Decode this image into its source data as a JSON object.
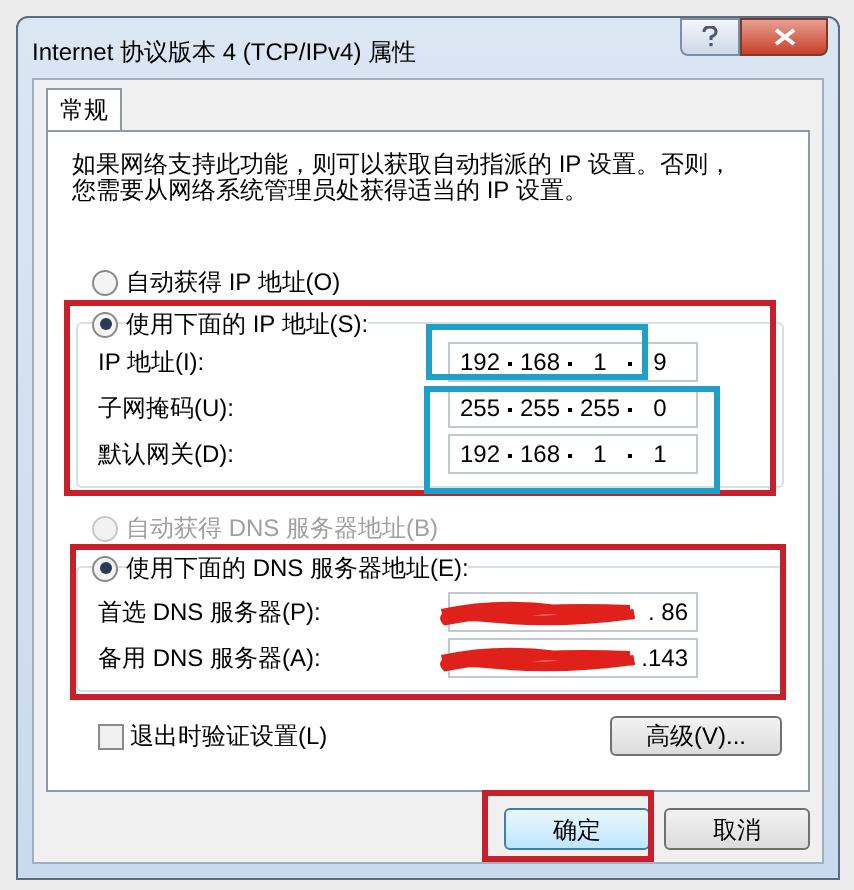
{
  "window": {
    "title": "Internet 协议版本 4 (TCP/IPv4) 属性"
  },
  "tabs": [
    {
      "label": "常规",
      "selected": true
    }
  ],
  "description_lines": [
    "如果网络支持此功能，则可以获取自动指派的 IP 设置。否则，",
    "您需要从网络系统管理员处获得适当的 IP 设置。"
  ],
  "ip_mode": [
    {
      "label": "自动获得 IP 地址(O)",
      "selected": false,
      "disabled": false
    },
    {
      "label": "使用下面的 IP 地址(S):",
      "selected": true,
      "disabled": false
    }
  ],
  "ip_fields": [
    {
      "label": "IP 地址(I):",
      "octets": [
        "192",
        "168",
        "1",
        "9"
      ]
    },
    {
      "label": "子网掩码(U):",
      "octets": [
        "255",
        "255",
        "255",
        "0"
      ]
    },
    {
      "label": "默认网关(D):",
      "octets": [
        "192",
        "168",
        "1",
        "1"
      ]
    }
  ],
  "dns_mode": [
    {
      "label": "自动获得 DNS 服务器地址(B)",
      "selected": false,
      "disabled": true
    },
    {
      "label": "使用下面的 DNS 服务器地址(E):",
      "selected": true,
      "disabled": false
    }
  ],
  "dns_fields": [
    {
      "label": "首选 DNS 服务器(P):",
      "visible_value": ". 86",
      "redacted": true
    },
    {
      "label": "备用 DNS 服务器(A):",
      "visible_value": ".143",
      "redacted": true
    }
  ],
  "validate_on_exit": {
    "label": "退出时验证设置(L)",
    "checked": false
  },
  "advanced_button": "高级(V)...",
  "buttons": [
    {
      "label": "确定",
      "default": true
    },
    {
      "label": "取消",
      "default": false
    }
  ],
  "annotations": [
    {
      "color": "#c8202a"
    },
    {
      "color": "#1ea0c8"
    },
    {
      "color": "#1ea0c8"
    },
    {
      "color": "#c8202a"
    },
    {
      "color": "#c8202a"
    }
  ]
}
